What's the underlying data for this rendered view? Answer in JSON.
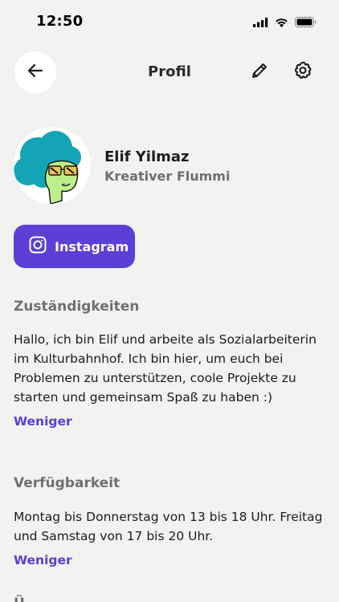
{
  "status_bar": {
    "time": "12:50",
    "icons": [
      "cellular-signal-icon",
      "wifi-icon",
      "battery-icon"
    ]
  },
  "header": {
    "title": "Profil",
    "back_icon": "arrow-left-icon",
    "edit_icon": "pencil-icon",
    "settings_icon": "gear-icon"
  },
  "profile": {
    "name": "Elif Yilmaz",
    "role": "Kreativer Flummi",
    "avatar_icon": "avatar-illustration"
  },
  "social": {
    "instagram_label": "Instagram",
    "instagram_icon": "instagram-icon"
  },
  "sections": [
    {
      "title": "Zuständigkeiten",
      "body": "Hallo, ich bin Elif und arbeite als Sozialarbeiterin im Kulturbahnhof. Ich bin hier, um euch bei Problemen zu unterstützen, coole Projekte zu starten und gemeinsam Spaß zu haben :)",
      "link": "Weniger"
    },
    {
      "title": "Verfügbarkeit",
      "body": "Montag bis Donnerstag von 13 bis 18 Uhr. Freitag und Samstag von 17 bis 20 Uhr.",
      "link": "Weniger"
    },
    {
      "title": "Ü"
    }
  ],
  "colors": {
    "background": "#f2f2f1",
    "accent": "#5b3fd6",
    "muted_text": "#707074",
    "text": "#1c1c1e",
    "avatar_hair": "#13a5b5",
    "avatar_skin": "#bdee8c",
    "avatar_glasses": "#f2c14a"
  }
}
